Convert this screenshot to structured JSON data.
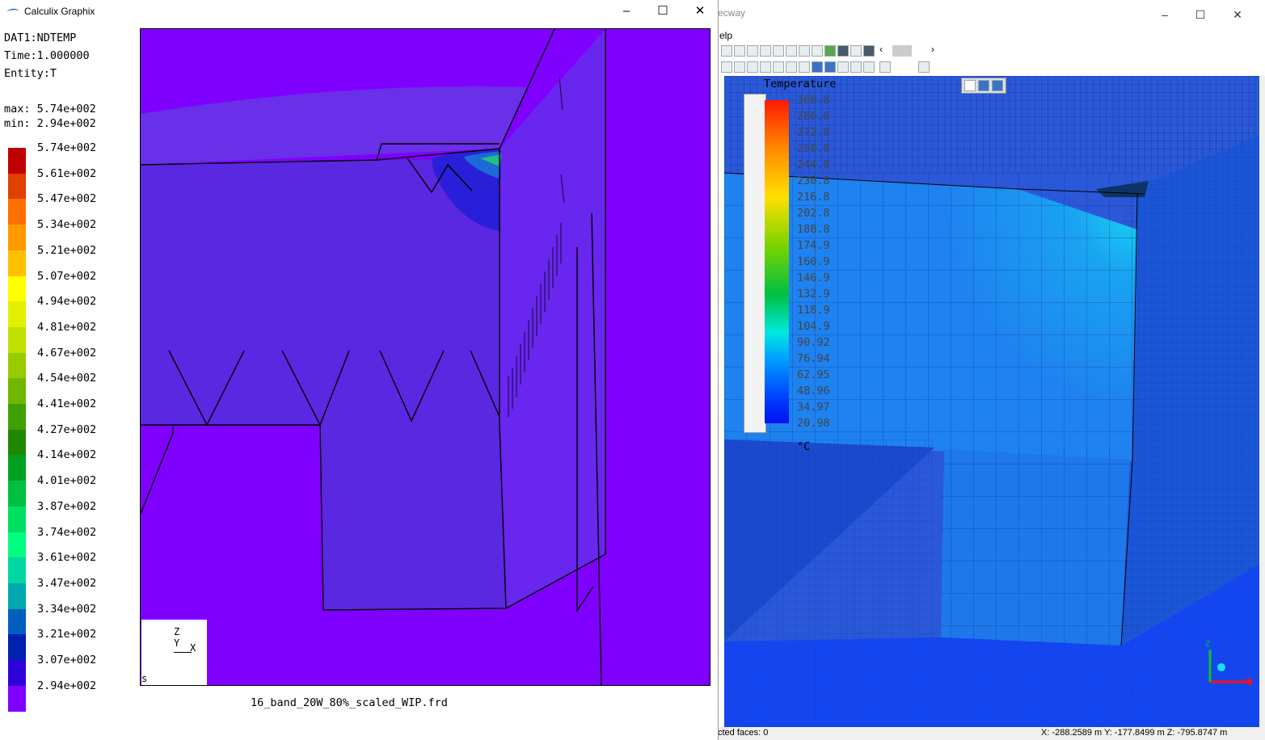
{
  "calculix": {
    "window_title": "Calculix Graphix",
    "info_lines": [
      "DAT1:NDTEMP",
      "Time:1.000000",
      "Entity:T"
    ],
    "max_label": "max: 5.74e+002",
    "min_label": "min: 2.94e+002",
    "legend": {
      "labels": [
        "5.74e+002",
        "5.61e+002",
        "5.47e+002",
        "5.34e+002",
        "5.21e+002",
        "5.07e+002",
        "4.94e+002",
        "4.81e+002",
        "4.67e+002",
        "4.54e+002",
        "4.41e+002",
        "4.27e+002",
        "4.14e+002",
        "4.01e+002",
        "3.87e+002",
        "3.74e+002",
        "3.61e+002",
        "3.47e+002",
        "3.34e+002",
        "3.21e+002",
        "3.07e+002",
        "2.94e+002"
      ],
      "colors": [
        "#c00000",
        "#e04000",
        "#ff7000",
        "#ff9a00",
        "#ffc000",
        "#ffff00",
        "#e0f000",
        "#c0e000",
        "#98cc00",
        "#70b800",
        "#40a000",
        "#208800",
        "#00a020",
        "#00c040",
        "#00e060",
        "#00ff80",
        "#00d8a0",
        "#00a8b0",
        "#0060c0",
        "#0020b0",
        "#3000d8",
        "#8000ff"
      ]
    },
    "triad": {
      "z": "Z",
      "y": "Y",
      "x": "X"
    },
    "corner_letter": "s",
    "filename": "16_band_20W_80%_scaled_WIP.frd",
    "colors": {
      "background_solid": "#8000ff",
      "face_shade": "#6a2fe8",
      "hot_spot": "#2a1fd8"
    }
  },
  "mecway": {
    "window_title": "ecway",
    "menu_fragment": "elp",
    "legend": {
      "title": "Temperature",
      "labels": [
        "300.8",
        "286.8",
        "272.8",
        "258.8",
        "244.8",
        "230.8",
        "216.8",
        "202.8",
        "188.8",
        "174.9",
        "160.9",
        "146.9",
        "132.9",
        "118.9",
        "104.9",
        "90.92",
        "76.94",
        "62.95",
        "48.96",
        "34.97",
        "20.98"
      ],
      "unit": "°C"
    },
    "status_left": "cted faces: 0",
    "status_right": "X: -288.2589 m Y: -177.8499 m Z: -795.8747 m",
    "axis_labels": {
      "z": "Z",
      "x": "X"
    },
    "colors": {
      "background": "#2a4fd1",
      "face_light": "#1e82f0",
      "face_mid": "#1c6ee6",
      "floor": "#1446f0"
    }
  }
}
